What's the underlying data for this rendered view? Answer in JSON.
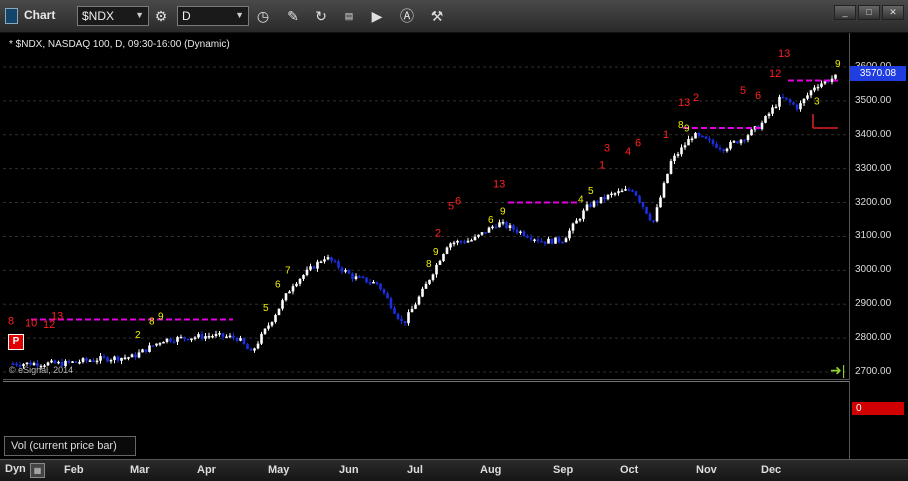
{
  "window": {
    "title": "Chart",
    "controls": [
      "_",
      "□",
      "✕"
    ]
  },
  "toolbar": {
    "symbol": "$NDX",
    "interval": "D",
    "icons": [
      "settings-gear-icon",
      "clock-icon",
      "pencil-icon",
      "refresh-icon",
      "study-icon",
      "play-icon",
      "alert-icon",
      "wand-icon"
    ]
  },
  "chart": {
    "header": "* $NDX, NASDAQ 100, D, 09:30-16:00 (Dynamic)",
    "watermark": "© eSignal, 2014",
    "last_price": "3570.08",
    "price_ticks": [
      "3600.00",
      "3500.00",
      "3400.00",
      "3300.00",
      "3200.00",
      "3100.00",
      "3000.00",
      "2900.00",
      "2800.00",
      "2700.00"
    ],
    "marker": "P",
    "up_color": "#ffffff",
    "down_color": "#1a2fe0",
    "setup_color": "#f0f000",
    "countdown_color": "#ff2020",
    "resistance_color": "#e000e0"
  },
  "volume": {
    "label": "Vol (current price bar)",
    "value": "0"
  },
  "time_axis": {
    "mode": "Dyn",
    "months": [
      "Feb",
      "Mar",
      "Apr",
      "May",
      "Jun",
      "Jul",
      "Aug",
      "Sep",
      "Oct",
      "Nov",
      "Dec"
    ]
  },
  "chart_data": {
    "type": "candlestick",
    "title": "* $NDX, NASDAQ 100, D, 09:30-16:00 (Dynamic)",
    "ylim": [
      2680,
      3660
    ],
    "x_months": [
      "Feb",
      "Mar",
      "Apr",
      "May",
      "Jun",
      "Jul",
      "Aug",
      "Sep",
      "Oct",
      "Nov",
      "Dec"
    ],
    "monthly_close_approx": [
      2720,
      2800,
      2810,
      2960,
      3020,
      3060,
      3140,
      3160,
      3230,
      3400,
      3570
    ],
    "resistance_levels": [
      2855,
      3200,
      3420,
      3560
    ],
    "support_level": 3420,
    "last_price": 3570.08,
    "countdown_labels": [
      "8",
      "10",
      "12",
      "13",
      "2",
      "5",
      "6",
      "13",
      "1",
      "3",
      "4",
      "6",
      "1",
      "13",
      "2",
      "5",
      "6",
      "12",
      "13"
    ],
    "setup_labels": [
      "2",
      "8",
      "9",
      "5",
      "6",
      "7",
      "8",
      "9",
      "6",
      "9",
      "4",
      "5",
      "8",
      "9",
      "3",
      "9"
    ]
  }
}
